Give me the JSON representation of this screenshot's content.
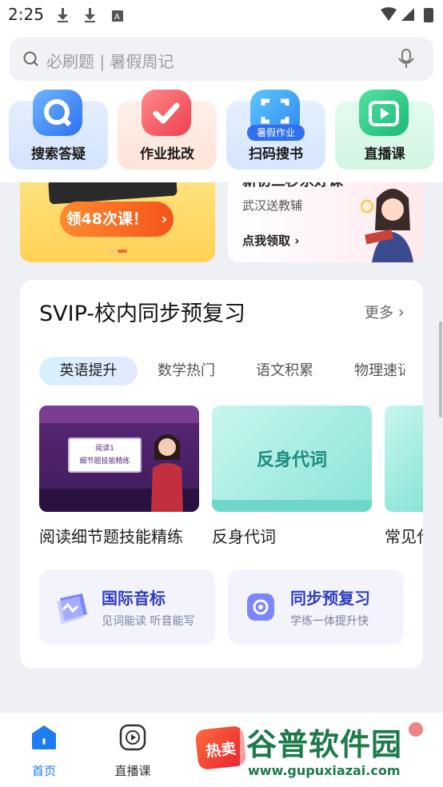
{
  "status": {
    "time": "2:25"
  },
  "search": {
    "placeholder": "必刷题 | 暑假周记"
  },
  "tiles": [
    {
      "label": "搜索答疑",
      "badge": ""
    },
    {
      "label": "作业批改",
      "badge": ""
    },
    {
      "label": "扫码搜书",
      "badge": "暑假作业"
    },
    {
      "label": "直播课",
      "badge": ""
    }
  ],
  "banner_left": {
    "cta": "领48次课！",
    "cta_arrow": "›"
  },
  "banner_right": {
    "title": "新初三秒杀好课",
    "subtitle": "武汉送教辅",
    "link": "点我领取",
    "link_arrow": "›"
  },
  "section": {
    "title": "SVIP-校内同步预复习",
    "more": "更多",
    "more_arrow": "›",
    "tabs": [
      "英语提升",
      "数学热门",
      "语文积累",
      "物理速记"
    ],
    "videos": [
      {
        "title": "阅读细节题技能精练",
        "board_line1": "阅读1",
        "board_line2": "细节题技能精练"
      },
      {
        "title": "反身代词",
        "cover_text": "反身代词"
      },
      {
        "title": "常见代"
      }
    ],
    "features": [
      {
        "title": "国际音标",
        "subtitle": "见词能读 听音能写"
      },
      {
        "title": "同步预复习",
        "subtitle": "学练一体提升快"
      }
    ]
  },
  "nav": {
    "items": [
      {
        "label": "首页",
        "active": true
      },
      {
        "label": "直播课",
        "active": false
      },
      {
        "label": "热卖",
        "active": false
      }
    ]
  },
  "watermark": {
    "text": "谷普软件园",
    "url_text": "www.gupuxiazai.com"
  },
  "colors": {
    "accent": "#1e7cf2",
    "orange": "#f5641e",
    "feature_title": "#2f3cc4"
  }
}
